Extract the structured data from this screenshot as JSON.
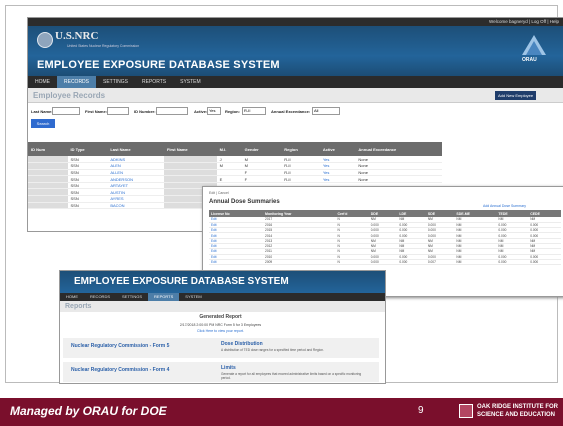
{
  "footer": {
    "left_text": "Managed by ORAU for DOE",
    "page_number": "9",
    "org_line1": "OAK RIDGE INSTITUTE FOR",
    "org_line2": "SCIENCE AND EDUCATION"
  },
  "app": {
    "welcome": "Welcome bagneryd | Log Off | Help",
    "agency": "U.S.NRC",
    "agency_sub": "United States Nuclear Regulatory Commission",
    "title": "EMPLOYEE EXPOSURE DATABASE SYSTEM",
    "brand": "ORAU",
    "nav": [
      "HOME",
      "RECORDS",
      "SETTINGS",
      "REPORTS",
      "SYSTEM"
    ],
    "active_nav": "RECORDS"
  },
  "records": {
    "heading": "Employee Records",
    "add_button": "Add New Employee",
    "filters": {
      "last_name": "Last Name:",
      "first_name": "First Name:",
      "id_number": "ID Number:",
      "active": "Active:",
      "active_value": "Yes",
      "region": "Region:",
      "region_value": "R-II",
      "annual_exceedance": "Annual Exceedance:",
      "annual_value": "All"
    },
    "search_button": "Search",
    "columns": [
      "ID Num",
      "ID Type",
      "Last Name",
      "First Name",
      "M.I.",
      "Gender",
      "Region",
      "Active",
      "Annual Exceedance"
    ],
    "rows": [
      {
        "id_type": "SSN",
        "last": "ADKINS",
        "mi": "J",
        "gender": "M",
        "region": "R-II",
        "active": "Yes",
        "exc": "None"
      },
      {
        "id_type": "SSN",
        "last": "ALEN",
        "mi": "M",
        "gender": "M",
        "region": "R-II",
        "active": "Yes",
        "exc": "None"
      },
      {
        "id_type": "SSN",
        "last": "ALLEN",
        "mi": "",
        "gender": "F",
        "region": "R-II",
        "active": "Yes",
        "exc": "None"
      },
      {
        "id_type": "SSN",
        "last": "ANDERSON",
        "mi": "E",
        "gender": "F",
        "region": "R-II",
        "active": "Yes",
        "exc": "None"
      },
      {
        "id_type": "SSN",
        "last": "ARTAYET",
        "mi": "",
        "gender": "",
        "region": "",
        "active": "",
        "exc": ""
      },
      {
        "id_type": "SSN",
        "last": "AUSTIN",
        "mi": "",
        "gender": "",
        "region": "",
        "active": "",
        "exc": ""
      },
      {
        "id_type": "SSN",
        "last": "AYRES",
        "mi": "",
        "gender": "",
        "region": "",
        "active": "",
        "exc": ""
      },
      {
        "id_type": "SSN",
        "last": "BACON",
        "mi": "",
        "gender": "",
        "region": "",
        "active": "",
        "exc": ""
      }
    ]
  },
  "dose": {
    "breadcrumb": "Edit | Cancel",
    "title": "Annual Dose Summaries",
    "add_link": "Add Annual Dose Summary",
    "columns": [
      "License No",
      "Monitoring Year",
      "Cert'd",
      "DDE",
      "LDE",
      "SDE",
      "SDE-ME",
      "TEDE",
      "CEDE"
    ],
    "rows": [
      [
        "Edit",
        "2017",
        "N",
        "NM",
        "NM",
        "NM",
        "NM",
        "NM",
        "NM"
      ],
      [
        "Edit",
        "2016",
        "N",
        "0.000",
        "0.000",
        "0.000",
        "NM",
        "0.000",
        "0.000"
      ],
      [
        "Edit",
        "2015",
        "N",
        "0.000",
        "0.000",
        "0.000",
        "NM",
        "0.000",
        "0.000"
      ],
      [
        "Edit",
        "2014",
        "N",
        "0.000",
        "0.000",
        "0.000",
        "NM",
        "0.000",
        "0.000"
      ],
      [
        "Edit",
        "2013",
        "N",
        "NM",
        "NM",
        "NM",
        "NM",
        "NM",
        "NM"
      ],
      [
        "Edit",
        "2012",
        "N",
        "NM",
        "NM",
        "NM",
        "NM",
        "NM",
        "NM"
      ],
      [
        "Edit",
        "2011",
        "N",
        "NM",
        "NM",
        "NM",
        "NM",
        "NM",
        "NM"
      ],
      [
        "Edit",
        "2010",
        "N",
        "0.000",
        "0.000",
        "0.000",
        "NM",
        "0.000",
        "0.000"
      ],
      [
        "Edit",
        "2009",
        "N",
        "0.000",
        "0.000",
        "0.007",
        "NM",
        "0.000",
        "0.000"
      ]
    ]
  },
  "reports": {
    "title": "EMPLOYEE EXPOSURE DATABASE SYSTEM",
    "nav": [
      "HOME",
      "RECORDS",
      "SETTINGS",
      "REPORTS",
      "SYSTEM"
    ],
    "active_nav": "REPORTS",
    "heading": "Reports",
    "generated_title": "Generated Report",
    "generated_sub": "2/17/2018 2:00:00 PM NRC Form 5 for 3 Employees",
    "generated_link": "Click Here to view your report.",
    "form5": "Nuclear Regulatory Commission - Form 5",
    "form4": "Nuclear Regulatory Commission - Form 4",
    "dose_dist": "Dose Distribution",
    "dose_dist_desc": "A distribution of TED dose ranges for a specified time period and Region.",
    "limits": "Limits",
    "limits_desc": "Generate a report for all employees that exceed administrative limits based on a specific monitoring period."
  }
}
